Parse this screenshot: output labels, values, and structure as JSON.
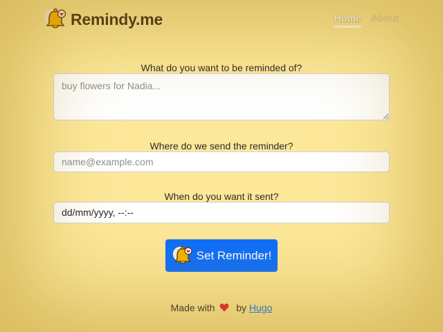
{
  "header": {
    "brand": "Remindy.me",
    "brand_icon": "bell-icon",
    "nav": [
      {
        "label": "Home",
        "active": true
      },
      {
        "label": "About",
        "active": false
      }
    ]
  },
  "form": {
    "reminder": {
      "label": "What do you want to be reminded of?",
      "placeholder": "buy flowers for Nadia...",
      "value": ""
    },
    "email": {
      "label": "Where do we send the reminder?",
      "placeholder": "name@example.com",
      "value": ""
    },
    "datetime": {
      "label": "When do you want it sent?",
      "value": "dd/mm/yyyy, --:--"
    },
    "submit": {
      "label": "Set Reminder!",
      "icon": "bell-icon"
    }
  },
  "footer": {
    "made_with": "Made with",
    "heart_icon": "heart-icon",
    "by": "by",
    "author": "Hugo"
  },
  "colors": {
    "background": "#fde89a",
    "primary": "#0d6efd",
    "heart": "#e0212e"
  }
}
